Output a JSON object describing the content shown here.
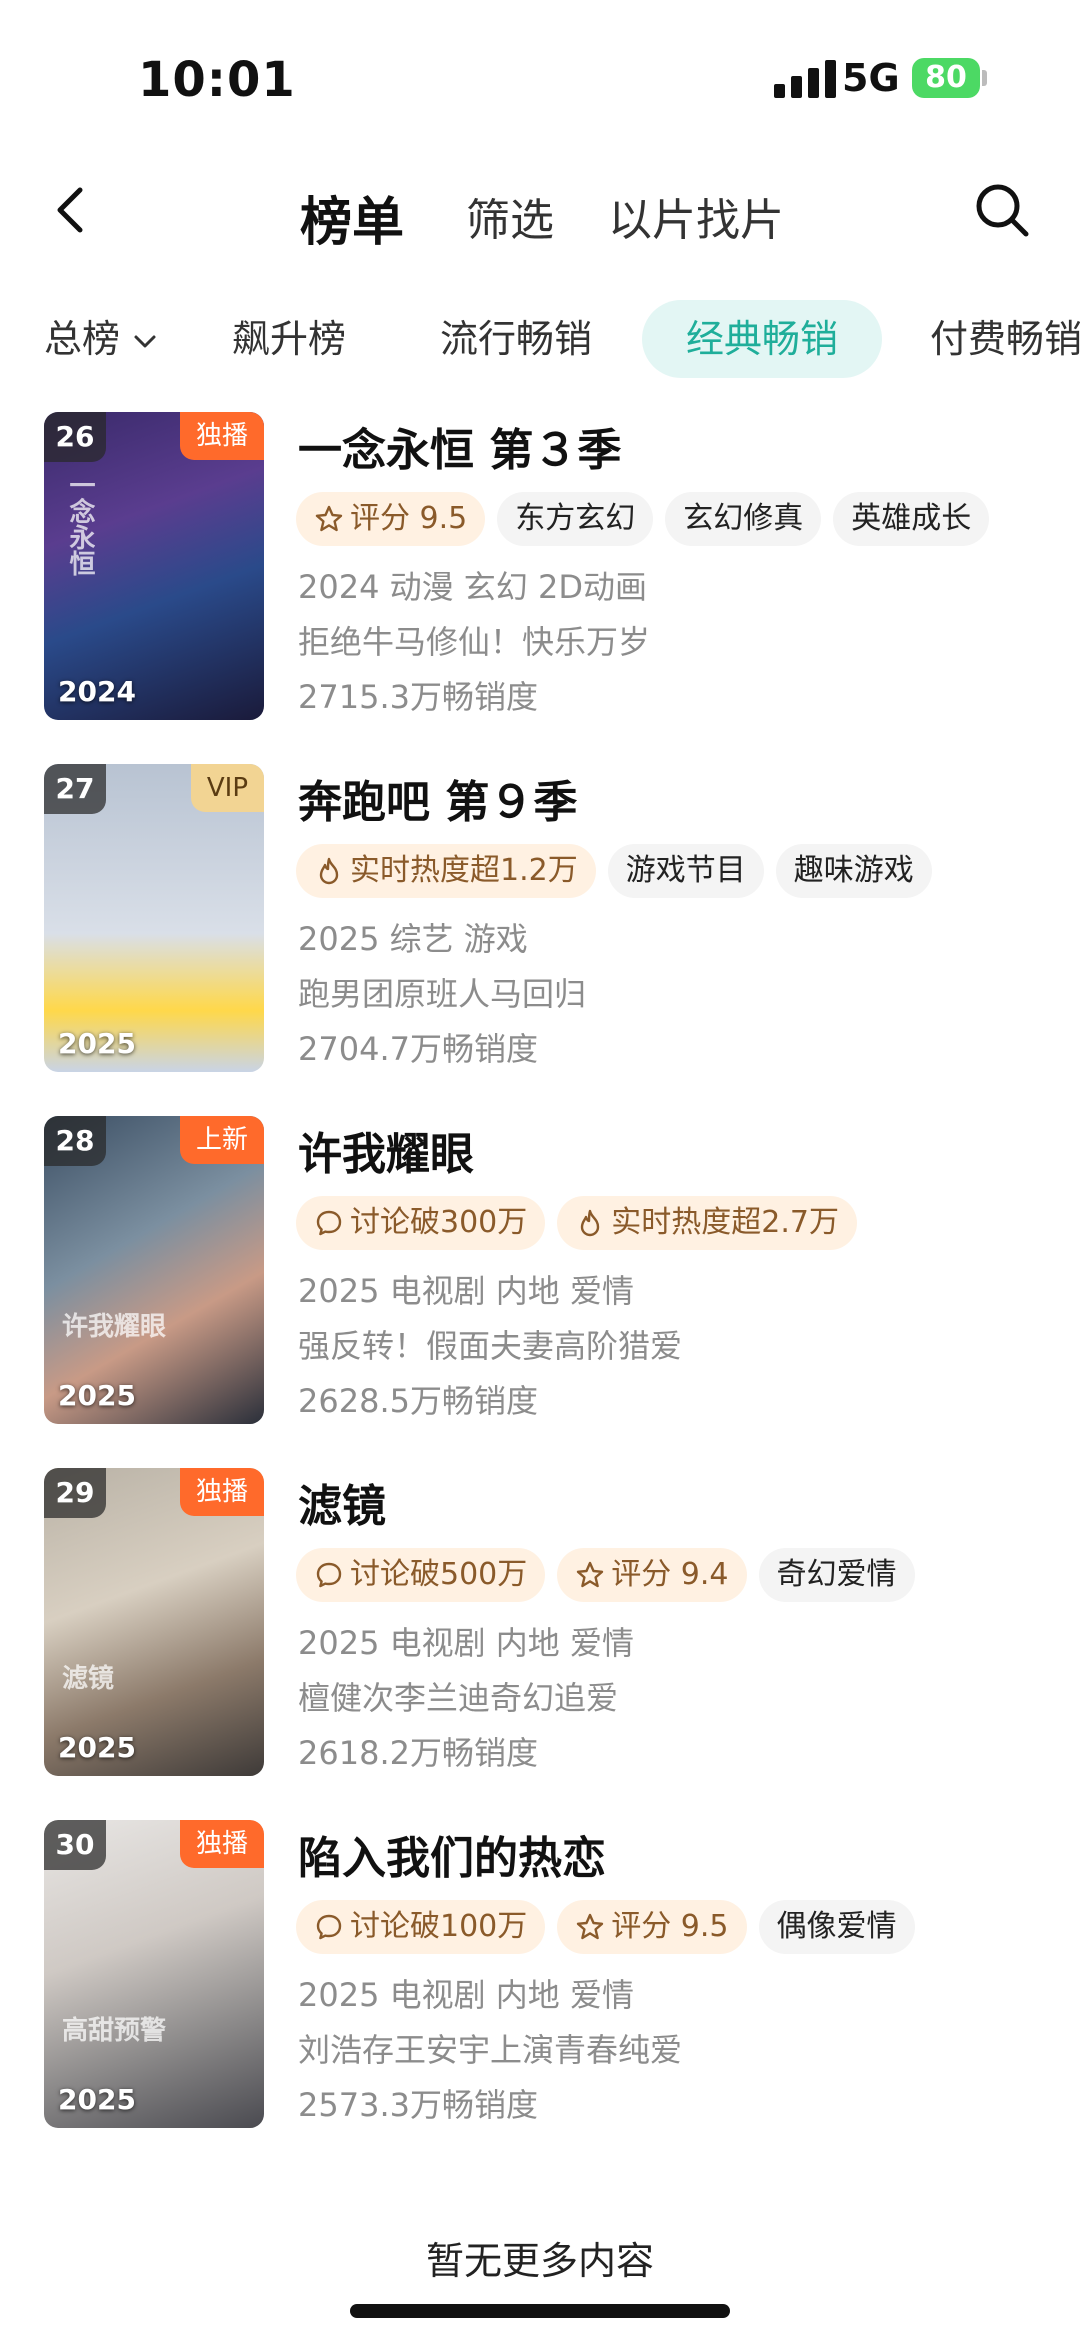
{
  "status": {
    "time": "10:01",
    "network": "5G",
    "battery": "80"
  },
  "nav": {
    "title": "榜单",
    "filter": "筛选",
    "find_by_clip": "以片找片"
  },
  "categories": [
    "总榜",
    "飙升榜",
    "流行畅销",
    "经典畅销",
    "付费畅销"
  ],
  "active_category": "经典畅销",
  "items": [
    {
      "rank": "26",
      "flag": "独播",
      "year": "2024",
      "title": "一念永恒 第３季",
      "tags": [
        {
          "icon": "star",
          "text": "评分 9.5",
          "hot": true
        },
        {
          "text": "东方玄幻"
        },
        {
          "text": "玄幻修真"
        },
        {
          "text": "英雄成长"
        }
      ],
      "info": "2024 动漫 玄幻 2D动画",
      "desc": "拒绝牛马修仙！快乐万岁",
      "sales": "2715.3万畅销度"
    },
    {
      "rank": "27",
      "flag": "VIP",
      "year": "2025",
      "title": "奔跑吧 第９季",
      "tags": [
        {
          "icon": "fire",
          "text": "实时热度超1.2万",
          "hot": true
        },
        {
          "text": "游戏节目"
        },
        {
          "text": "趣味游戏"
        }
      ],
      "info": "2025 综艺 游戏",
      "desc": "跑男团原班人马回归",
      "sales": "2704.7万畅销度"
    },
    {
      "rank": "28",
      "flag": "上新",
      "year": "2025",
      "title": "许我耀眼",
      "tags": [
        {
          "icon": "bubble",
          "text": "讨论破300万",
          "hot": true
        },
        {
          "icon": "fire",
          "text": "实时热度超2.7万",
          "hot": true
        }
      ],
      "info": "2025 电视剧 内地 爱情",
      "desc": "强反转！假面夫妻高阶猎爱",
      "sales": "2628.5万畅销度"
    },
    {
      "rank": "29",
      "flag": "独播",
      "year": "2025",
      "title": "滤镜",
      "tags": [
        {
          "icon": "bubble",
          "text": "讨论破500万",
          "hot": true
        },
        {
          "icon": "star",
          "text": "评分 9.4",
          "hot": true
        },
        {
          "text": "奇幻爱情"
        }
      ],
      "info": "2025 电视剧 内地 爱情",
      "desc": "檀健次李兰迪奇幻追爱",
      "sales": "2618.2万畅销度"
    },
    {
      "rank": "30",
      "flag": "独播",
      "year": "2025",
      "title": "陷入我们的热恋",
      "tags": [
        {
          "icon": "bubble",
          "text": "讨论破100万",
          "hot": true
        },
        {
          "icon": "star",
          "text": "评分 9.5",
          "hot": true
        },
        {
          "text": "偶像爱情"
        }
      ],
      "info": "2025 电视剧 内地 爱情",
      "desc": "刘浩存王安宇上演青春纯爱",
      "sales": "2573.3万畅销度"
    }
  ],
  "footer": "暂无更多内容",
  "colors": {
    "accent": "#1fae9a",
    "accent_bg": "#e3f6f4",
    "flag_orange": "#ff6a2b",
    "hot_tag_bg": "#fff1e2"
  }
}
